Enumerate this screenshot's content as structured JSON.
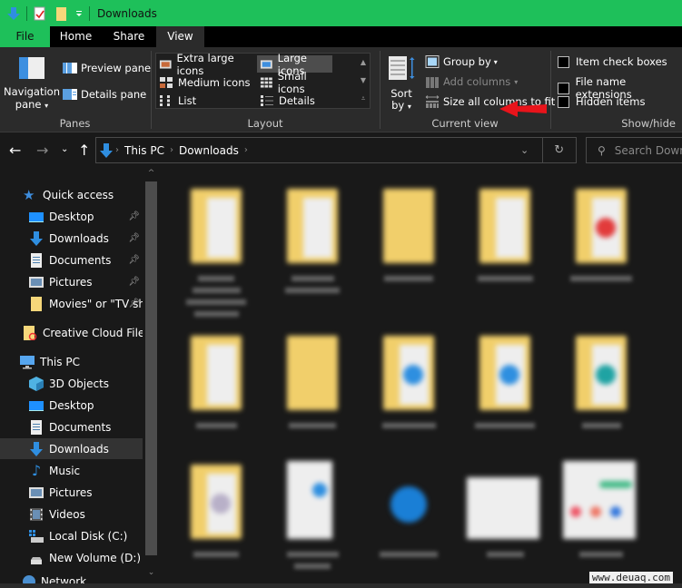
{
  "window": {
    "title": "Downloads",
    "qat_icons": [
      "downloads-arrow-icon",
      "properties-icon",
      "new-folder-icon",
      "customize-dropdown-icon"
    ]
  },
  "tabs": [
    {
      "label": "File",
      "active": false
    },
    {
      "label": "Home",
      "active": false
    },
    {
      "label": "Share",
      "active": false
    },
    {
      "label": "View",
      "active": true
    }
  ],
  "ribbon": {
    "panes": {
      "label": "Panes",
      "navigation_pane": "Navigation",
      "navigation_pane_line2": "pane",
      "preview_pane": "Preview pane",
      "details_pane": "Details pane"
    },
    "layout": {
      "label": "Layout",
      "items": [
        {
          "label": "Extra large icons",
          "selected": false
        },
        {
          "label": "Large icons",
          "selected": true
        },
        {
          "label": "Medium icons",
          "selected": false
        },
        {
          "label": "Small icons",
          "selected": false
        },
        {
          "label": "List",
          "selected": false
        },
        {
          "label": "Details",
          "selected": false
        }
      ]
    },
    "current_view": {
      "label": "Current view",
      "sort_by": "Sort",
      "sort_by_line2": "by",
      "group_by": "Group by",
      "add_columns": "Add columns",
      "size_columns": "Size all columns to fit"
    },
    "show_hide": {
      "label": "Show/hide",
      "checkboxes": [
        {
          "label": "Item check boxes",
          "checked": false
        },
        {
          "label": "File name extensions",
          "checked": false
        },
        {
          "label": "Hidden items",
          "checked": false
        }
      ]
    },
    "annotation_arrow_color": "#e8141b"
  },
  "address_bar": {
    "breadcrumbs": [
      "This PC",
      "Downloads"
    ],
    "search_placeholder": "Search Downloads"
  },
  "sidebar": {
    "quick_access": {
      "label": "Quick access",
      "items": [
        {
          "label": "Desktop",
          "icon": "desktop-icon",
          "pinned": true
        },
        {
          "label": "Downloads",
          "icon": "downloads-icon",
          "pinned": true
        },
        {
          "label": "Documents",
          "icon": "documents-icon",
          "pinned": true
        },
        {
          "label": "Pictures",
          "icon": "pictures-icon",
          "pinned": true
        },
        {
          "label": "Movies\" or \"TV sh",
          "icon": "folder-icon",
          "pinned": true
        }
      ]
    },
    "creative_cloud": {
      "label": "Creative Cloud Files"
    },
    "this_pc": {
      "label": "This PC",
      "items": [
        {
          "label": "3D Objects",
          "icon": "3d-objects-icon"
        },
        {
          "label": "Desktop",
          "icon": "desktop-icon"
        },
        {
          "label": "Documents",
          "icon": "documents-icon"
        },
        {
          "label": "Downloads",
          "icon": "downloads-icon",
          "selected": true
        },
        {
          "label": "Music",
          "icon": "music-icon"
        },
        {
          "label": "Pictures",
          "icon": "pictures-icon"
        },
        {
          "label": "Videos",
          "icon": "videos-icon"
        },
        {
          "label": "Local Disk (C:)",
          "icon": "local-disk-icon"
        },
        {
          "label": "New Volume (D:)",
          "icon": "drive-icon"
        }
      ]
    },
    "network": {
      "label": "Network"
    }
  },
  "content": {
    "view": "Large icons",
    "items_note": "Item names are blurred in the screenshot",
    "items": [
      {
        "kind": "folder",
        "preview": "document"
      },
      {
        "kind": "folder",
        "preview": "document"
      },
      {
        "kind": "folder",
        "preview": "none"
      },
      {
        "kind": "folder",
        "preview": "document"
      },
      {
        "kind": "folder",
        "preview": "red"
      },
      {
        "kind": "folder",
        "preview": "document"
      },
      {
        "kind": "folder",
        "preview": "none"
      },
      {
        "kind": "folder",
        "preview": "blue"
      },
      {
        "kind": "folder",
        "preview": "blue"
      },
      {
        "kind": "folder",
        "preview": "teal"
      },
      {
        "kind": "folder",
        "preview": "image"
      },
      {
        "kind": "file",
        "preview": "screenshot"
      },
      {
        "kind": "file",
        "preview": "blue-app"
      },
      {
        "kind": "file",
        "preview": "white-doc"
      },
      {
        "kind": "file",
        "preview": "ui-screenshot"
      }
    ]
  },
  "watermark": "www.deuaq.com",
  "colors": {
    "title_bar": "#1ec05a",
    "ribbon_bg": "#2b2b2b",
    "window_bg": "#191919",
    "accent_blue": "#2f8ee0",
    "folder_yellow": "#f1cf6b"
  }
}
